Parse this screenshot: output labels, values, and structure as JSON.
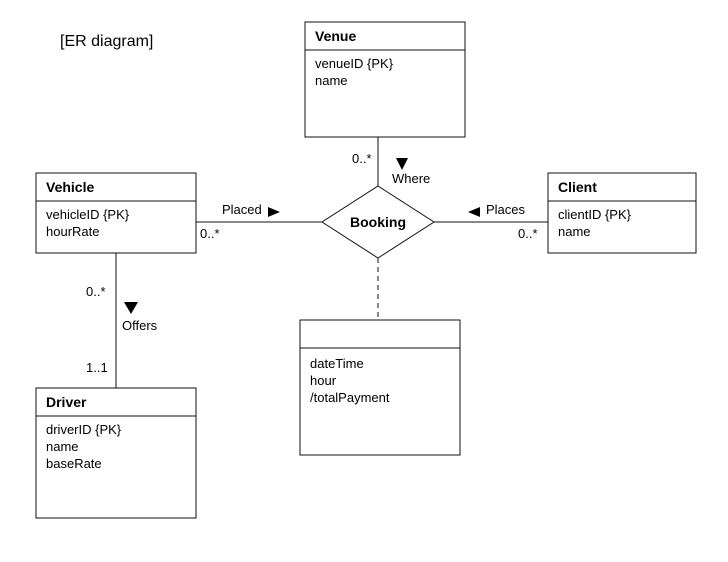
{
  "title": "[ER diagram]",
  "entities": {
    "venue": {
      "name": "Venue",
      "attrs": [
        "venueID {PK}",
        "name"
      ]
    },
    "vehicle": {
      "name": "Vehicle",
      "attrs": [
        "vehicleID {PK}",
        "hourRate"
      ]
    },
    "client": {
      "name": "Client",
      "attrs": [
        "clientID {PK}",
        "name"
      ]
    },
    "driver": {
      "name": "Driver",
      "attrs": [
        "driverID {PK}",
        "name",
        "baseRate"
      ]
    },
    "bookingAttrs": {
      "attrs": [
        "dateTime",
        "hour",
        "/totalPayment"
      ]
    }
  },
  "relationship": {
    "name": "Booking"
  },
  "associations": {
    "where": {
      "label": "Where",
      "mult": "0..*"
    },
    "placed": {
      "label": "Placed",
      "mult": "0..*"
    },
    "places": {
      "label": "Places",
      "mult": "0..*"
    },
    "offers": {
      "label": "Offers",
      "multTop": "0..*",
      "multBottom": "1..1"
    }
  }
}
